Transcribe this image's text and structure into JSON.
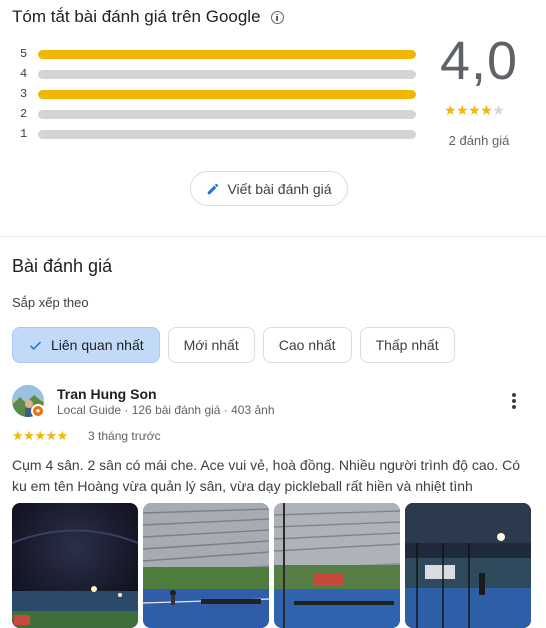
{
  "summary": {
    "title": "Tóm tắt bài đánh giá trên Google",
    "info_icon": "info-icon",
    "distribution": [
      {
        "stars": "5",
        "fraction": 1.0
      },
      {
        "stars": "4",
        "fraction": 0.0
      },
      {
        "stars": "3",
        "fraction": 1.0
      },
      {
        "stars": "2",
        "fraction": 0.0
      },
      {
        "stars": "1",
        "fraction": 0.0
      }
    ],
    "average": "4,0",
    "average_stars": 4,
    "review_count": "2 đánh giá",
    "write_review_label": "Viết bài đánh giá",
    "write_icon": "pencil-icon"
  },
  "reviews": {
    "title": "Bài đánh giá",
    "sort_label": "Sắp xếp theo",
    "sort_options": [
      "Liên quan nhất",
      "Mới nhất",
      "Cao nhất",
      "Thấp nhất"
    ],
    "selected_sort": "Liên quan nhất",
    "items": [
      {
        "author": "Tran Hung Son",
        "meta": "Local Guide · 126 bài đánh giá · 403 ảnh",
        "rating": 5,
        "time": "3 tháng trước",
        "text": "Cụm 4 sân. 2 sân có mái che. Ace vui vẻ, hoà đồng. Nhiều người trình độ cao. Có ku em tên Hoàng vừa quản lý sân, vừa dạy pickleball rất hiền và nhiệt tình",
        "photo_count": 4
      }
    ]
  },
  "colors": {
    "star": "#f2b605",
    "track": "#d4d4d4",
    "chip_active": "#c2daf8"
  }
}
